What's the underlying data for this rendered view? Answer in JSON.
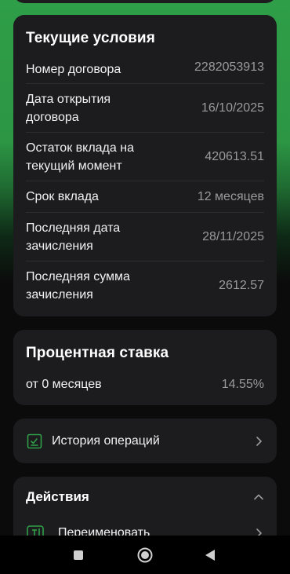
{
  "terms": {
    "title": "Текущие условия",
    "rows": [
      {
        "label": "Номер договора",
        "value": "2282053913"
      },
      {
        "label": "Дата открытия договора",
        "value": "16/10/2025"
      },
      {
        "label": "Остаток вклада на текущий момент",
        "value": "420613.51"
      },
      {
        "label": "Срок вклада",
        "value": "12 месяцев"
      },
      {
        "label": "Последняя дата зачисления",
        "value": "28/11/2025"
      },
      {
        "label": "Последняя сумма зачисления",
        "value": "2612.57"
      }
    ]
  },
  "rate": {
    "title": "Процентная ставка",
    "label": "от 0 месяцев",
    "value": "14.55%"
  },
  "history": {
    "label": "История операций",
    "icon": "history-document-icon"
  },
  "actions": {
    "title": "Действия",
    "items": [
      {
        "label": "Переименовать",
        "icon": "rename-icon"
      }
    ]
  },
  "colors": {
    "accent_green": "#2f9e48",
    "card_bg": "#1c1c1e",
    "muted_text": "#9a9a9e"
  }
}
